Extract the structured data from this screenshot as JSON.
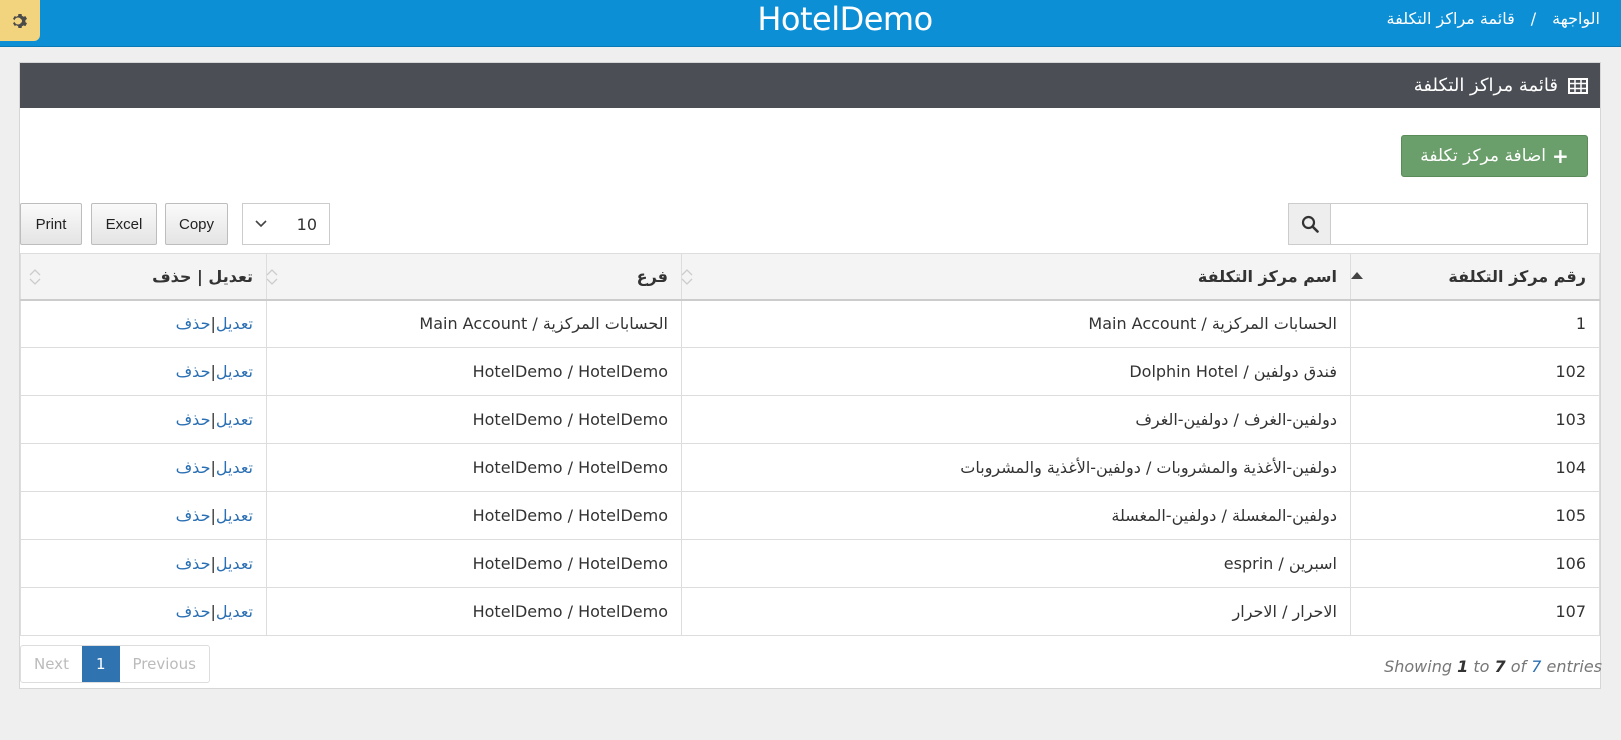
{
  "header": {
    "brand": "HotelDemo",
    "breadcrumb": [
      "الواجهة",
      "/",
      "قائمة مراكز التكلفة"
    ]
  },
  "panel": {
    "title": "قائمة مراكز التكلفة",
    "add_button": "اضافة مركز تكلفة"
  },
  "toolbar": {
    "print": "Print",
    "excel": "Excel",
    "copy": "Copy",
    "page_length": "10",
    "search_placeholder": ""
  },
  "table": {
    "headers": [
      "رقم مركز التكلفة",
      "اسم مركز التكلفة",
      "فرع",
      "تعديل | حذف"
    ],
    "rows": [
      {
        "num": "1",
        "name": "الحسابات المركزية / Main Account",
        "branch": "الحسابات المركزية / Main Account",
        "edit": "تعديل",
        "sep": "|",
        "del": "حذف"
      },
      {
        "num": "102",
        "name": "فندق دولفين / Dolphin Hotel",
        "branch": "HotelDemo / HotelDemo",
        "edit": "تعديل",
        "sep": "|",
        "del": "حذف"
      },
      {
        "num": "103",
        "name": "دولفين-الغرف / دولفين-الغرف",
        "branch": "HotelDemo / HotelDemo",
        "edit": "تعديل",
        "sep": "|",
        "del": "حذف"
      },
      {
        "num": "104",
        "name": "دولفين-الأغذية والمشروبات / دولفين-الأغذية والمشروبات",
        "branch": "HotelDemo / HotelDemo",
        "edit": "تعديل",
        "sep": "|",
        "del": "حذف"
      },
      {
        "num": "105",
        "name": "دولفين-المغسلة / دولفين-المغسلة",
        "branch": "HotelDemo / HotelDemo",
        "edit": "تعديل",
        "sep": "|",
        "del": "حذف"
      },
      {
        "num": "106",
        "name": "اسبرين / esprin",
        "branch": "HotelDemo / HotelDemo",
        "edit": "تعديل",
        "sep": "|",
        "del": "حذف"
      },
      {
        "num": "107",
        "name": "الاحرار / الاحرار",
        "branch": "HotelDemo / HotelDemo",
        "edit": "تعديل",
        "sep": "|",
        "del": "حذف"
      }
    ]
  },
  "footer": {
    "info": {
      "showing": "Showing",
      "from": "1",
      "to_word": "to",
      "to": "7",
      "of_word": "of",
      "total": "7",
      "entries": "entries"
    },
    "pager": {
      "next": "Next",
      "page": "1",
      "previous": "Previous"
    }
  },
  "colors": {
    "topbar": "#0d8fd6",
    "panel_head": "#4b4f55",
    "add_button": "#6a9e6a",
    "link": "#2a6fb3",
    "gear_bg": "#f2d37e"
  },
  "icons": {
    "settings": "gear-icon",
    "table": "table-icon",
    "add": "plus-icon",
    "search": "search-icon",
    "dropdown": "chevron-down-icon",
    "sort": "sort-icon"
  }
}
